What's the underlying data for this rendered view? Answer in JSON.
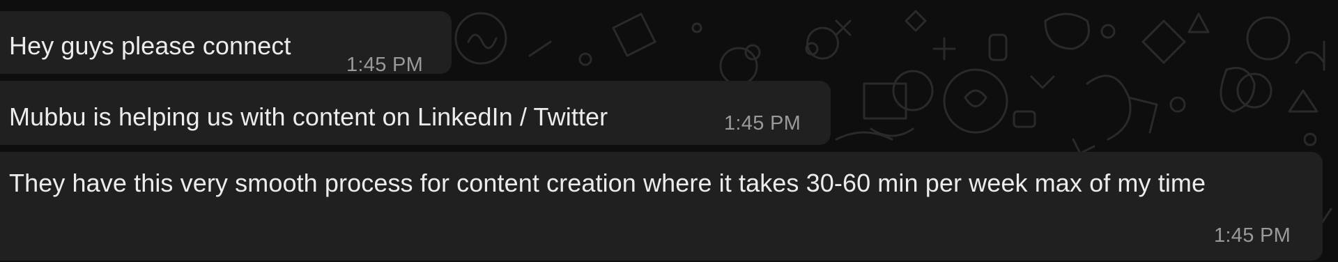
{
  "messages": [
    {
      "text": "Hey guys please connect",
      "time": "1:45 PM"
    },
    {
      "text": "Mubbu is helping us with content on LinkedIn / Twitter",
      "time": "1:45 PM"
    },
    {
      "text": "They have this very smooth process for content creation where it takes 30-60 min per week max of my time",
      "time": "1:45 PM"
    }
  ],
  "colors": {
    "background": "#0e0e0e",
    "bubble": "#202020",
    "text": "#ececec",
    "timestamp": "#9a9a9a"
  }
}
